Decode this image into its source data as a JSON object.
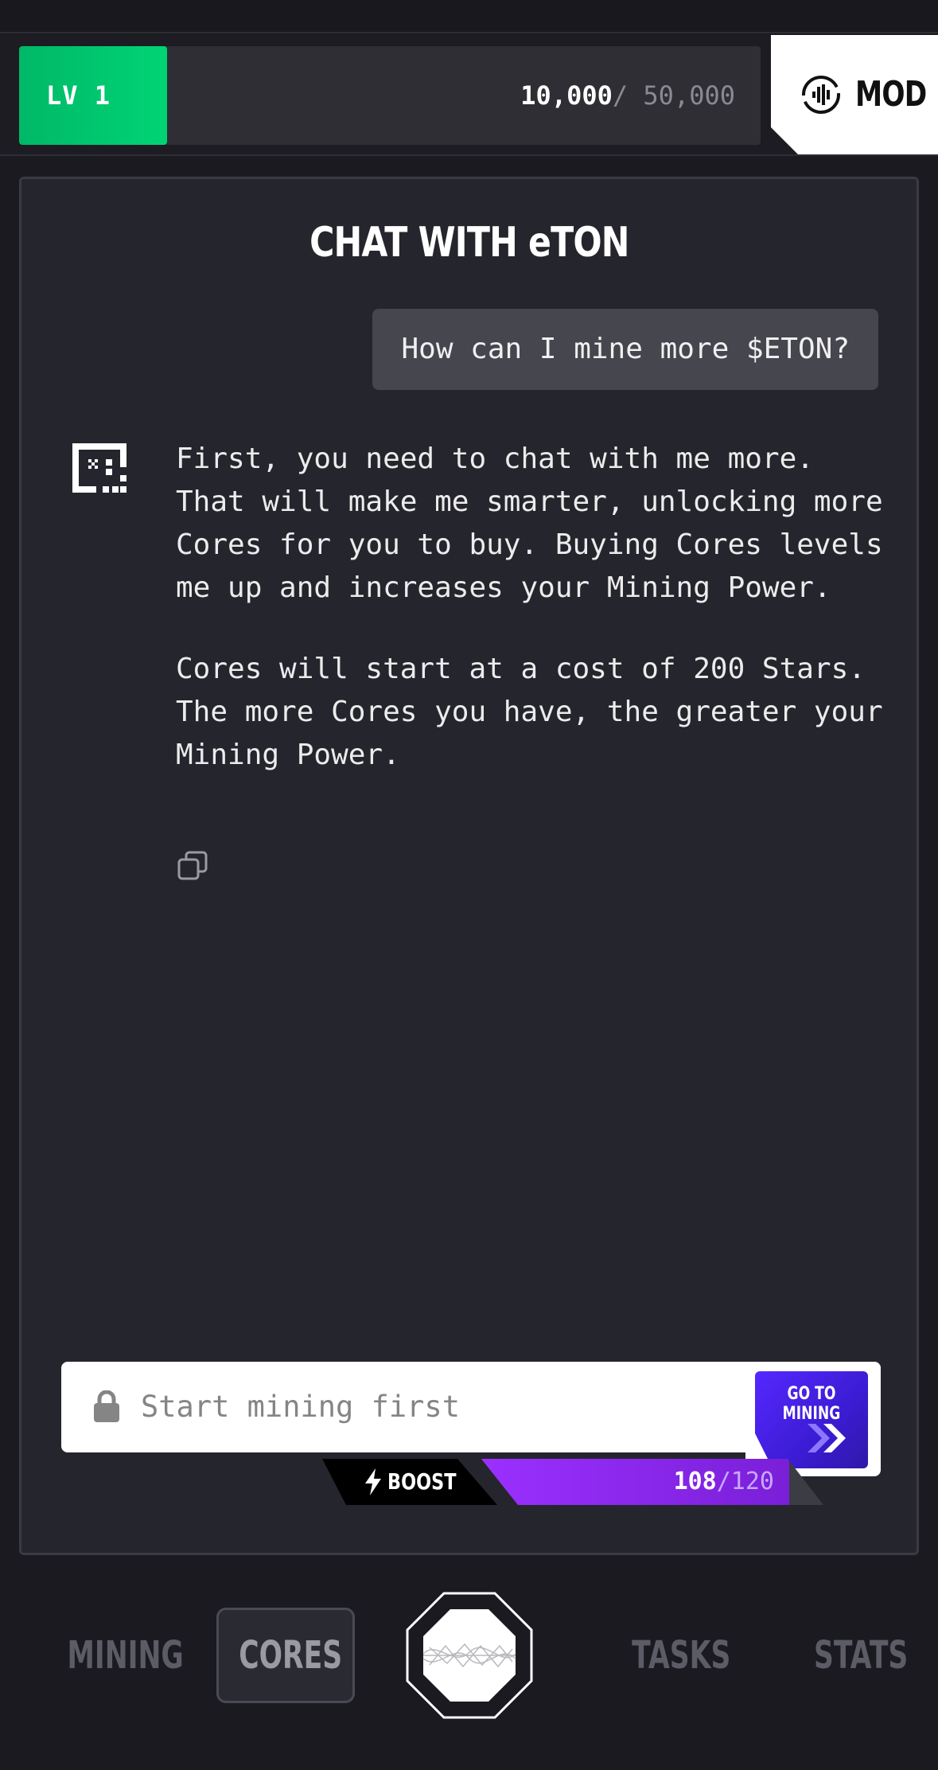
{
  "header": {
    "level_label": "LV 1",
    "progress_current": "10,000",
    "progress_max": "/ 50,000",
    "progress_fraction": 0.2,
    "mod_label": "MOD"
  },
  "chat": {
    "title": "CHAT WITH eTON",
    "user_message": "How can I mine more $ETON?",
    "bot_paragraphs": [
      "First, you need to chat with me more. That will make me smarter, unlocking more Cores for you to buy. Buying Cores levels me up and increases your Mining Power.",
      "Cores will start at a cost of 200 Stars. The more Cores you have, the greater your Mining Power."
    ],
    "input_placeholder": "Start mining first",
    "go_mining_label": "GO TO MINING"
  },
  "boost": {
    "label": "BOOST",
    "current": "108",
    "max": "/120",
    "fraction": 0.9
  },
  "nav": {
    "items": [
      {
        "label": "MINING"
      },
      {
        "label": "CORES",
        "active": true
      },
      {
        "label": "TASKS"
      },
      {
        "label": "STATS"
      }
    ]
  },
  "colors": {
    "level_green": "#00d474",
    "boost_purple": "#9b30ff",
    "mining_button": "#4a24e8",
    "panel_bg": "#25252d"
  },
  "icons": [
    "mod-voice-icon",
    "bot-avatar-icon",
    "copy-icon",
    "lock-icon",
    "chevrons-right-icon",
    "bolt-icon",
    "eton-logo-icon"
  ]
}
